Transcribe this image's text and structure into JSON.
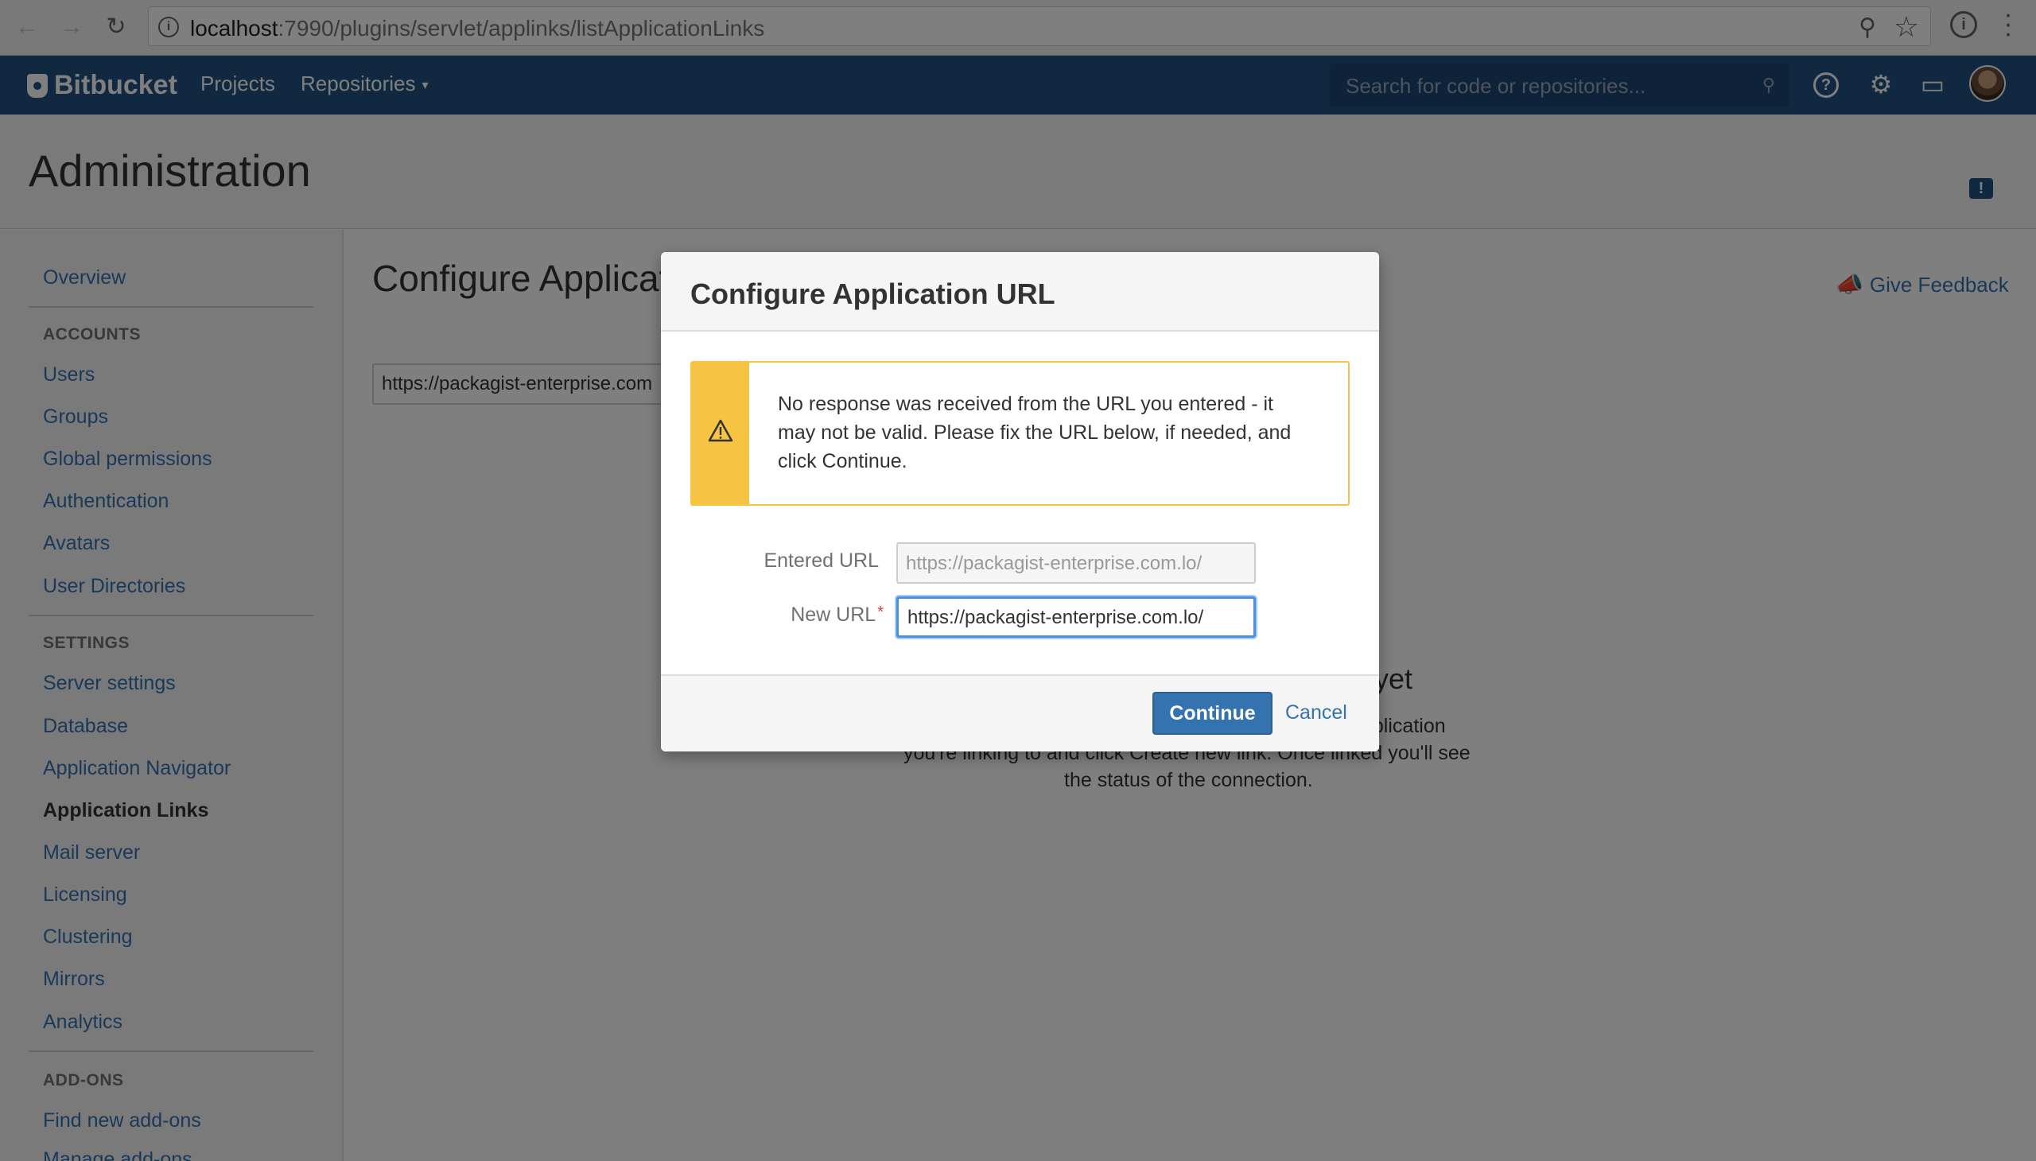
{
  "browser": {
    "url_host": "localhost",
    "url_path": ":7990/plugins/servlet/applinks/listApplicationLinks"
  },
  "header": {
    "logo": "Bitbucket",
    "nav": [
      "Projects",
      "Repositories"
    ],
    "search_placeholder": "Search for code or repositories..."
  },
  "page": {
    "title": "Administration"
  },
  "sidebar": {
    "overview": "Overview",
    "accounts_heading": "ACCOUNTS",
    "accounts": [
      "Users",
      "Groups",
      "Global permissions",
      "Authentication",
      "Avatars",
      "User Directories"
    ],
    "settings_heading": "SETTINGS",
    "settings": [
      "Server settings",
      "Database",
      "Application Navigator",
      "Application Links",
      "Mail server",
      "Licensing",
      "Clustering",
      "Mirrors",
      "Analytics"
    ],
    "active_item": "Application Links",
    "addons_heading": "ADD-ONS",
    "addons": [
      "Find new add-ons",
      "Manage add-ons"
    ]
  },
  "main": {
    "title": "Configure Applicati",
    "feedback": "Give Feedback",
    "url_value": "https://packagist-enterprise.com",
    "empty_title": "s yet",
    "empty_line1": "pplication",
    "empty_line2": "you're linking to and click Create new link. Once linked you'll see",
    "empty_line3": "the status of the connection."
  },
  "dialog": {
    "title": "Configure Application URL",
    "warning": "No response was received from the URL you entered - it may not be valid. Please fix the URL below, if needed, and click Continue.",
    "entered_url_label": "Entered URL",
    "entered_url_value": "https://packagist-enterprise.com.lo/",
    "new_url_label": "New URL",
    "new_url_value": "https://packagist-enterprise.com.lo/",
    "continue": "Continue",
    "cancel": "Cancel"
  },
  "colors": {
    "header": "#205081",
    "link": "#3572b0",
    "warning": "#f6c342",
    "primary_button": "#3572b0"
  }
}
